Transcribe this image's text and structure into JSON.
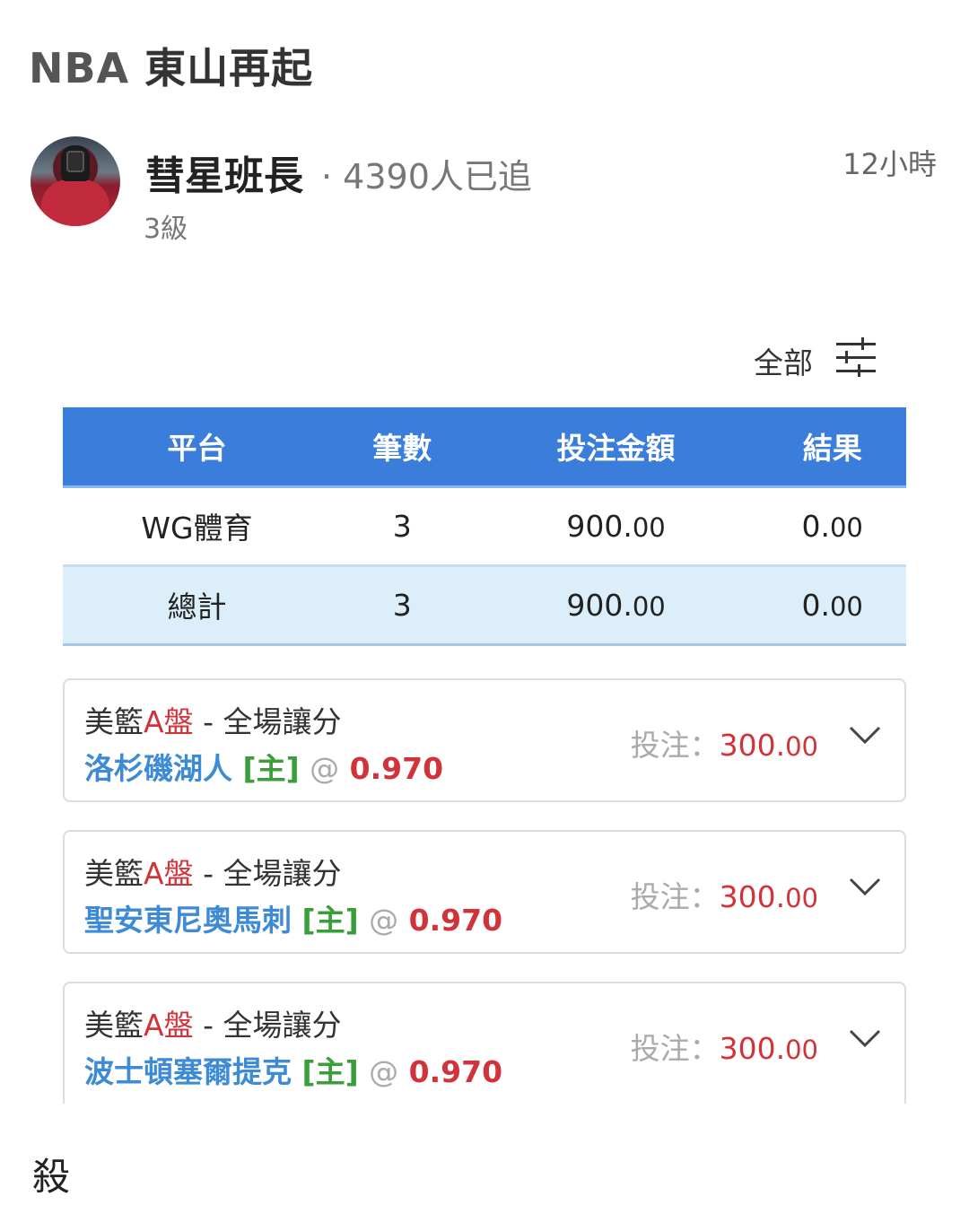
{
  "post": {
    "title_prefix": "NBA",
    "title_main": " 東山再起",
    "author": "彗星班長",
    "followers": "· 4390人已追",
    "level": "3級",
    "time": "12小時",
    "comment": "殺"
  },
  "filter": {
    "label": "全部",
    "icon": "sliders-icon"
  },
  "summary": {
    "headers": [
      "平台",
      "筆數",
      "投注金額",
      "結果"
    ],
    "rows": [
      {
        "platform": "WG體育",
        "count": "3",
        "amount_int": "900.",
        "amount_dec": "00",
        "result_int": "0.",
        "result_dec": "00"
      },
      {
        "platform": "總計",
        "count": "3",
        "amount_int": "900.",
        "amount_dec": "00",
        "result_int": "0.",
        "result_dec": "00"
      }
    ]
  },
  "bets": [
    {
      "league_a": "美籃",
      "league_b": "A盤",
      "market": " - 全場讓分",
      "team": "洛杉磯湖人",
      "side": "[主]",
      "at": "@",
      "odds": "0.970",
      "stake_label": "投注：",
      "stake_int": "300.",
      "stake_dec": "00"
    },
    {
      "league_a": "美籃",
      "league_b": "A盤",
      "market": " - 全場讓分",
      "team": "聖安東尼奧馬刺",
      "side": "[主]",
      "at": "@",
      "odds": "0.970",
      "stake_label": "投注：",
      "stake_int": "300.",
      "stake_dec": "00"
    },
    {
      "league_a": "美籃",
      "league_b": "A盤",
      "market": " - 全場讓分",
      "team": "波士頓塞爾提克",
      "side": "[主]",
      "at": "@",
      "odds": "0.970",
      "stake_label": "投注：",
      "stake_int": "300.",
      "stake_dec": "00"
    }
  ],
  "colors": {
    "header_blue": "#3a7ddb",
    "total_row": "#dbeefa",
    "red": "#d0343a",
    "team_blue": "#3d8bd6",
    "home_green": "#3a9e3a"
  }
}
